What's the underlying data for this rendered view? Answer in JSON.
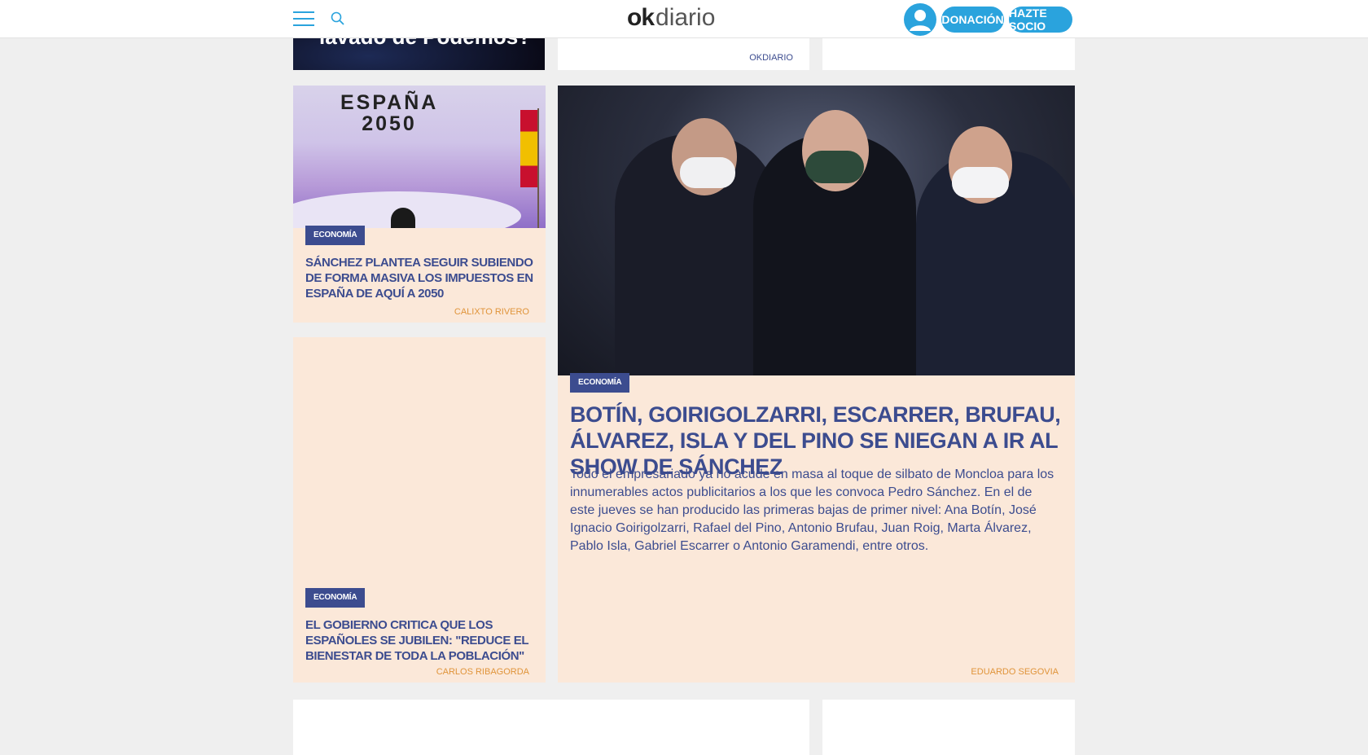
{
  "header": {
    "logo_ok": "ok",
    "logo_diario": "diario",
    "donate_label": "DONACIÓN",
    "socio_label": "HAZTE SOCIO"
  },
  "colors": {
    "brand": "#2aa3dd",
    "headline": "#3c4c8f",
    "author": "#e0943a",
    "card_peach": "#fbe8d9"
  },
  "top_row": {
    "left_caption": "lavado de Podemos?",
    "middle_author": "OKDIARIO"
  },
  "articles": [
    {
      "tag": "ECONOMÍA",
      "title": "SÁNCHEZ PLANTEA SEGUIR SUBIENDO DE FORMA MASIVA LOS IMPUESTOS EN ESPAÑA DE AQUÍ A 2050",
      "author": "CALIXTO RIVERO",
      "image_text": "ESPAÑA 2050"
    },
    {
      "tag": "ECONOMÍA",
      "title": "EL GOBIERNO CRITICA QUE LOS ESPAÑOLES SE JUBILEN: \"REDUCE EL BIENESTAR DE TODA LA POBLACIÓN\"",
      "author": "CARLOS RIBAGORDA"
    },
    {
      "tag": "ECONOMÍA",
      "title": "BOTÍN, GOIRIGOLZARRI, ESCARRER, BRUFAU, ÁLVAREZ, ISLA Y DEL PINO SE NIEGAN A IR AL SHOW DE SÁNCHEZ",
      "summary": "Todo el empresariado ya no acude en masa al toque de silbato de Moncloa para los innumerables actos publicitarios a los que les convoca Pedro Sánchez. En el de este jueves se han producido las primeras bajas de primer nivel: Ana Botín, José Ignacio Goirigolzarri, Rafael del Pino, Antonio Brufau, Juan Roig, Marta Álvarez, Pablo Isla, Gabriel Escarrer o Antonio Garamendi, entre otros.",
      "author": "EDUARDO SEGOVIA"
    }
  ]
}
